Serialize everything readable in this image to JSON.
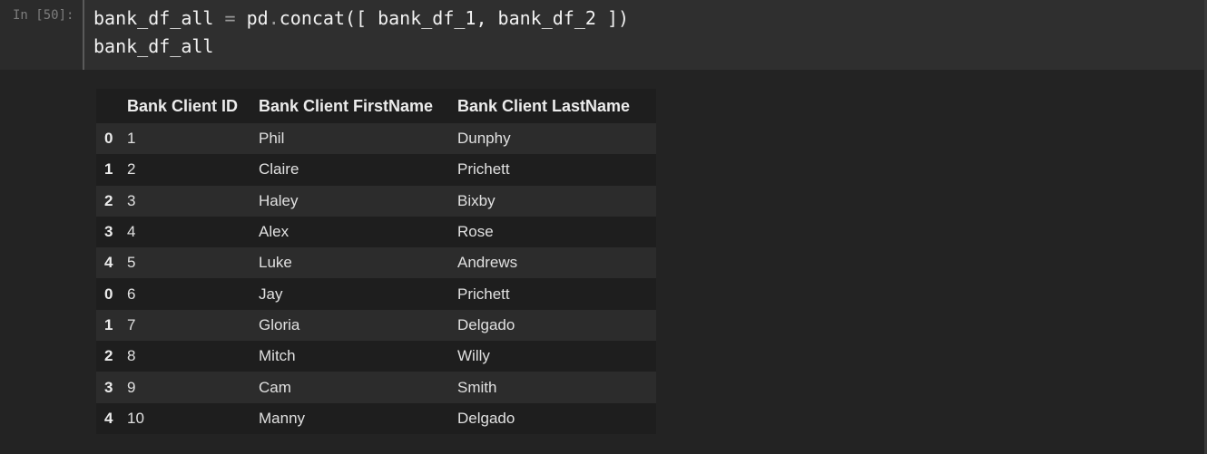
{
  "cell": {
    "prompt": "In [50]:",
    "code": {
      "line1": {
        "lhs": "bank_df_all",
        "op": "=",
        "obj": "pd",
        "dot": ".",
        "call": "concat([ bank_df_1, bank_df_2 ])"
      },
      "line2": "bank_df_all"
    }
  },
  "dataframe": {
    "columns": [
      "",
      "Bank Client ID",
      "Bank Client FirstName",
      "Bank Client LastName"
    ],
    "rows": [
      {
        "index": "0",
        "id": "1",
        "first": "Phil",
        "last": "Dunphy"
      },
      {
        "index": "1",
        "id": "2",
        "first": "Claire",
        "last": "Prichett"
      },
      {
        "index": "2",
        "id": "3",
        "first": "Haley",
        "last": "Bixby"
      },
      {
        "index": "3",
        "id": "4",
        "first": "Alex",
        "last": "Rose"
      },
      {
        "index": "4",
        "id": "5",
        "first": "Luke",
        "last": "Andrews"
      },
      {
        "index": "0",
        "id": "6",
        "first": "Jay",
        "last": "Prichett"
      },
      {
        "index": "1",
        "id": "7",
        "first": "Gloria",
        "last": "Delgado"
      },
      {
        "index": "2",
        "id": "8",
        "first": "Mitch",
        "last": "Willy"
      },
      {
        "index": "3",
        "id": "9",
        "first": "Cam",
        "last": "Smith"
      },
      {
        "index": "4",
        "id": "10",
        "first": "Manny",
        "last": "Delgado"
      }
    ]
  },
  "colors": {
    "input_bg": "#2f2f2f",
    "output_bg": "#232323",
    "row_odd": "#2c2c2c",
    "row_even": "#1e1e1e",
    "prompt": "#7d7d7d"
  }
}
